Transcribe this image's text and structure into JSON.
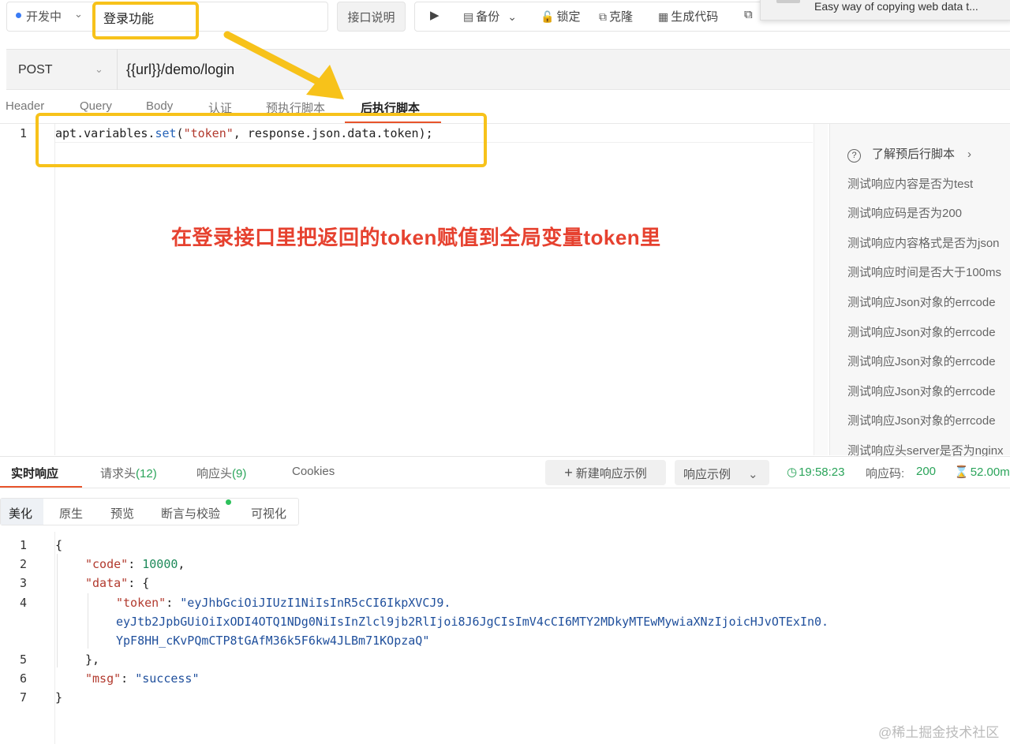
{
  "header": {
    "status": "开发中",
    "api_name": "登录功能",
    "doc_button": "接口说明",
    "toolbar": {
      "run_icon": "play-icon",
      "backup": "备份",
      "lock": "锁定",
      "clone": "克隆",
      "gen_code": "生成代码"
    },
    "popup_text": "Easy way of copying web data t..."
  },
  "request": {
    "method": "POST",
    "url": "{{url}}/demo/login",
    "tabs": [
      "Header",
      "Query",
      "Body",
      "认证",
      "预执行脚本",
      "后执行脚本"
    ],
    "active_tab": "后执行脚本",
    "script": {
      "line_no": "1",
      "obj": "apt.variables.",
      "fn": "set",
      "open": "(",
      "arg1": "\"token\"",
      "rest": ", response.json.data.token);"
    }
  },
  "snippets": {
    "help": "了解预后行脚本",
    "items": [
      "测试响应内容是否为test",
      "测试响应码是否为200",
      "测试响应内容格式是否为json",
      "测试响应时间是否大于100ms",
      "测试响应Json对象的errcode",
      "测试响应Json对象的errcode",
      "测试响应Json对象的errcode",
      "测试响应Json对象的errcode",
      "测试响应Json对象的errcode",
      "测试响应头server是否为nginx"
    ]
  },
  "annotation": "在登录接口里把返回的token赋值到全局变量token里",
  "response": {
    "tabs": {
      "realtime": "实时响应",
      "req_headers": "请求头",
      "req_headers_count": "(12)",
      "resp_headers": "响应头",
      "resp_headers_count": "(9)",
      "cookies": "Cookies"
    },
    "new_example": "新建响应示例",
    "example_select": "响应示例",
    "time": "19:58:23",
    "code_label": "响应码:",
    "code": "200",
    "size": "52.00m",
    "view_tabs": [
      "美化",
      "原生",
      "预览",
      "断言与校验",
      "可视化"
    ],
    "body": {
      "open": "{",
      "code_key": "\"code\"",
      "code_val": "10000",
      "data_key": "\"data\"",
      "token_key": "\"token\"",
      "token_1": "\"eyJhbGciOiJIUzI1NiIsInR5cCI6IkpXVCJ9.",
      "token_2": "eyJtb2JpbGUiOiIxODI4OTQ1NDg0NiIsInZlcl9jb2RlIjoi8J6JgCIsImV4cCI6MTY2MDkyMTEwMywiaXNzIjoicHJvOTExIn0.",
      "token_3": "YpF8HH_cKvPQmCTP8tGAfM36k5F6kw4JLBm71KOpzaQ\"",
      "close_data": "},",
      "msg_key": "\"msg\"",
      "msg_val": "\"success\"",
      "close": "}",
      "line_numbers": [
        "1",
        "2",
        "3",
        "4",
        "5",
        "6",
        "7"
      ]
    }
  },
  "watermark": "@稀土掘金技术社区"
}
